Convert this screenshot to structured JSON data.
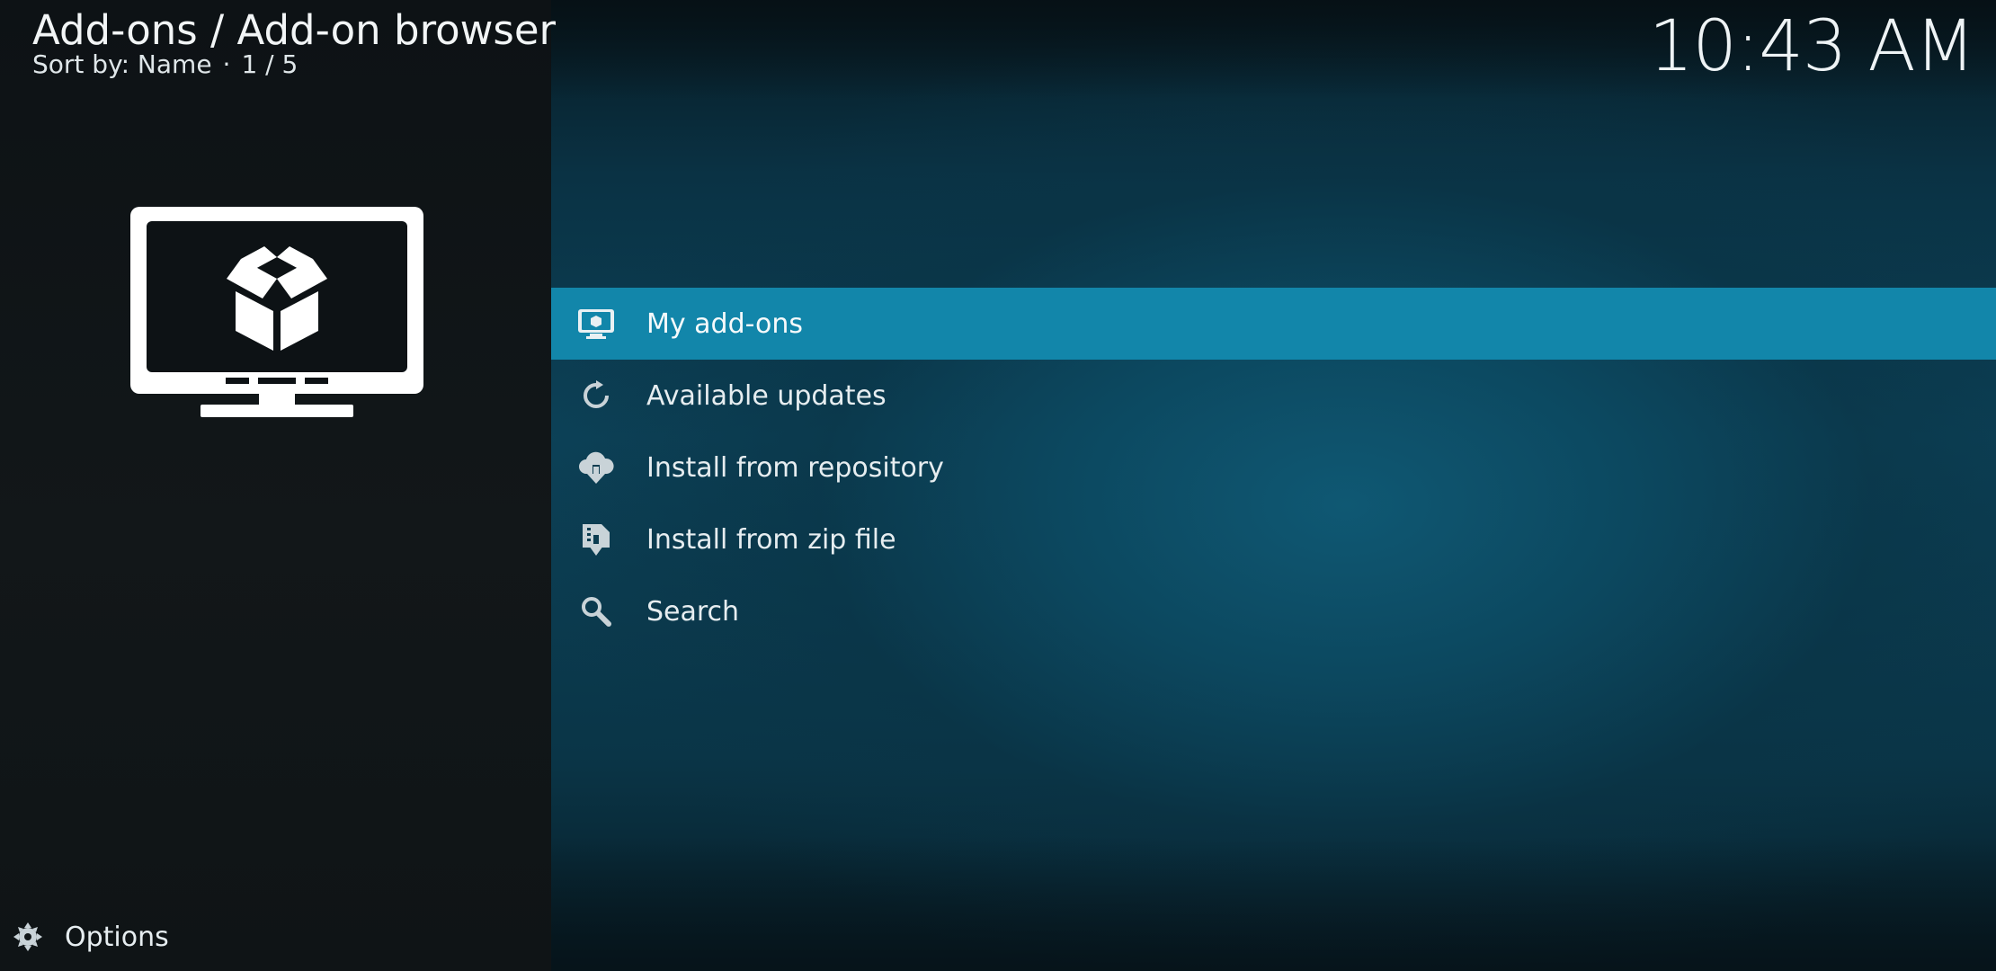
{
  "header": {
    "title": "Add-ons / Add-on browser",
    "sort_label": "Sort by: Name",
    "separator": "·",
    "position": "1 / 5"
  },
  "clock": "10:43 AM",
  "menu": {
    "items": [
      {
        "label": "My add-ons",
        "icon": "monitor-box-icon",
        "focused": true
      },
      {
        "label": "Available updates",
        "icon": "refresh-icon",
        "focused": false
      },
      {
        "label": "Install from repository",
        "icon": "cloud-download-icon",
        "focused": false
      },
      {
        "label": "Install from zip file",
        "icon": "zip-download-icon",
        "focused": false
      },
      {
        "label": "Search",
        "icon": "search-icon",
        "focused": false
      }
    ]
  },
  "options": {
    "label": "Options",
    "icon": "options-icon"
  },
  "colors": {
    "focus": "#1286aa",
    "left_panel": "#121719",
    "background": "#0c4157"
  }
}
